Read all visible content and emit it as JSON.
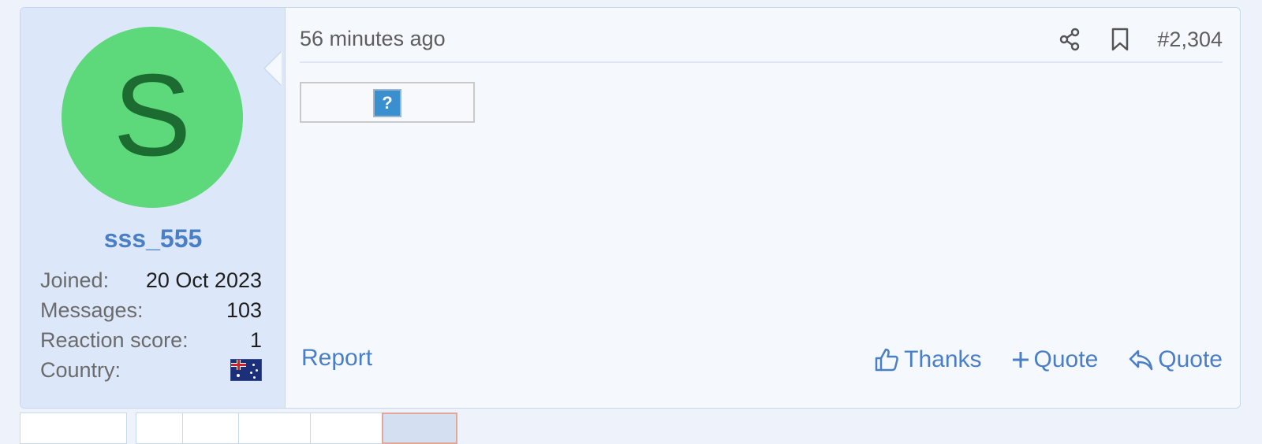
{
  "user": {
    "avatar_letter": "S",
    "username": "sss_555",
    "stats": [
      {
        "label": "Joined:",
        "value": "20 Oct 2023"
      },
      {
        "label": "Messages:",
        "value": "103"
      },
      {
        "label": "Reaction score:",
        "value": "1"
      },
      {
        "label": "Country:",
        "value": ""
      }
    ],
    "country_flag_icon": "australia-flag-icon"
  },
  "post": {
    "timestamp": "56 minutes ago",
    "number": "#2,304",
    "share_icon": "share-icon",
    "bookmark_icon": "bookmark-icon",
    "image_placeholder_glyph": "?"
  },
  "footer": {
    "report_label": "Report",
    "thanks_label": "Thanks",
    "multiquote_label": "Quote",
    "reply_label": "Quote"
  },
  "colors": {
    "accent": "#4a7fc6",
    "avatar_bg": "#5dd87a",
    "avatar_fg": "#1c6b30",
    "panel_bg": "#dce8f9"
  }
}
